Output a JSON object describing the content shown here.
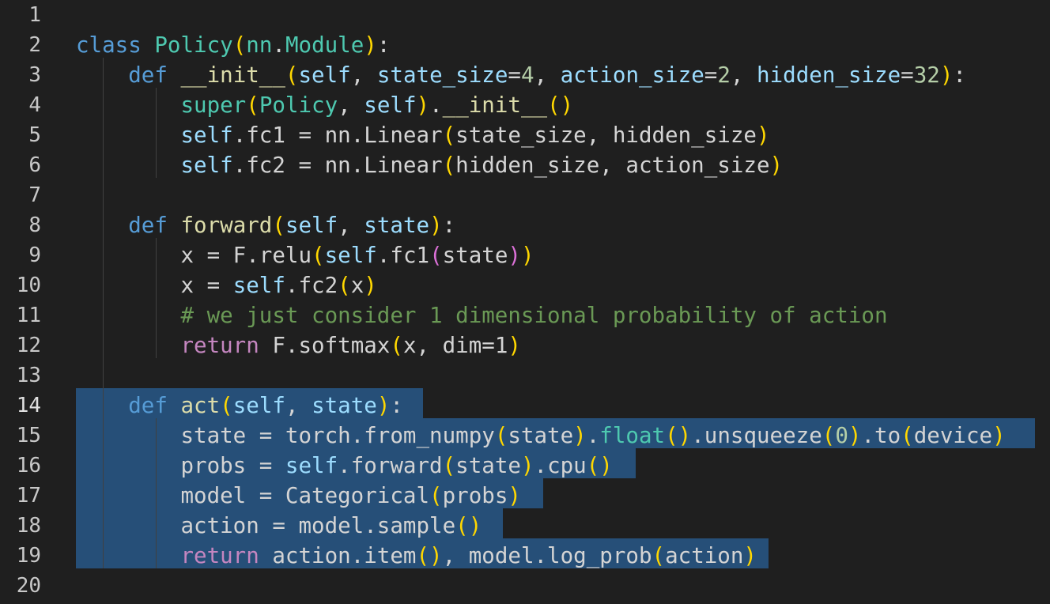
{
  "colors": {
    "background": "#1f1f1f",
    "selection": "#264f78",
    "line_number": "#c8c8c8",
    "default": "#d4d4d4",
    "keyword": "#569cd6",
    "class_name": "#4ec9b0",
    "function": "#dcdcaa",
    "variable": "#9cdcfe",
    "control": "#c586c0",
    "number": "#b5cea8",
    "comment": "#6a9955",
    "bracket_gold": "#ffd700",
    "bracket_purple": "#da70d6"
  },
  "editor": {
    "selection_start_line": 14,
    "selection_end_line": 19,
    "lines": [
      {
        "n": "1",
        "tokens": []
      },
      {
        "n": "2",
        "tokens": [
          [
            "class",
            "keyword"
          ],
          [
            " ",
            "default"
          ],
          [
            "Policy",
            "class_name"
          ],
          [
            "(",
            "bracket_gold"
          ],
          [
            "nn",
            "class_name"
          ],
          [
            ".",
            "default"
          ],
          [
            "Module",
            "class_name"
          ],
          [
            ")",
            "bracket_gold"
          ],
          [
            ":",
            "default"
          ]
        ]
      },
      {
        "n": "3",
        "tokens": [
          [
            "    ",
            "default"
          ],
          [
            "def",
            "keyword"
          ],
          [
            " ",
            "default"
          ],
          [
            "__init__",
            "function"
          ],
          [
            "(",
            "bracket_gold"
          ],
          [
            "self",
            "variable"
          ],
          [
            ", ",
            "default"
          ],
          [
            "state_size",
            "variable"
          ],
          [
            "=",
            "default"
          ],
          [
            "4",
            "number"
          ],
          [
            ", ",
            "default"
          ],
          [
            "action_size",
            "variable"
          ],
          [
            "=",
            "default"
          ],
          [
            "2",
            "number"
          ],
          [
            ", ",
            "default"
          ],
          [
            "hidden_size",
            "variable"
          ],
          [
            "=",
            "default"
          ],
          [
            "32",
            "number"
          ],
          [
            ")",
            "bracket_gold"
          ],
          [
            ":",
            "default"
          ]
        ]
      },
      {
        "n": "4",
        "tokens": [
          [
            "        ",
            "default"
          ],
          [
            "super",
            "class_name"
          ],
          [
            "(",
            "bracket_gold"
          ],
          [
            "Policy",
            "class_name"
          ],
          [
            ", ",
            "default"
          ],
          [
            "self",
            "variable"
          ],
          [
            ")",
            "bracket_gold"
          ],
          [
            ".",
            "default"
          ],
          [
            "__init__",
            "function"
          ],
          [
            "()",
            "bracket_gold"
          ]
        ]
      },
      {
        "n": "5",
        "tokens": [
          [
            "        ",
            "default"
          ],
          [
            "self",
            "variable"
          ],
          [
            ".fc1 = nn.Linear",
            "default"
          ],
          [
            "(",
            "bracket_gold"
          ],
          [
            "state_size, hidden_size",
            "default"
          ],
          [
            ")",
            "bracket_gold"
          ]
        ]
      },
      {
        "n": "6",
        "tokens": [
          [
            "        ",
            "default"
          ],
          [
            "self",
            "variable"
          ],
          [
            ".fc2 = nn.Linear",
            "default"
          ],
          [
            "(",
            "bracket_gold"
          ],
          [
            "hidden_size, action_size",
            "default"
          ],
          [
            ")",
            "bracket_gold"
          ]
        ]
      },
      {
        "n": "7",
        "tokens": []
      },
      {
        "n": "8",
        "tokens": [
          [
            "    ",
            "default"
          ],
          [
            "def",
            "keyword"
          ],
          [
            " ",
            "default"
          ],
          [
            "forward",
            "function"
          ],
          [
            "(",
            "bracket_gold"
          ],
          [
            "self",
            "variable"
          ],
          [
            ", ",
            "default"
          ],
          [
            "state",
            "variable"
          ],
          [
            ")",
            "bracket_gold"
          ],
          [
            ":",
            "default"
          ]
        ]
      },
      {
        "n": "9",
        "tokens": [
          [
            "        ",
            "default"
          ],
          [
            "x = F.relu",
            "default"
          ],
          [
            "(",
            "bracket_gold"
          ],
          [
            "self",
            "variable"
          ],
          [
            ".fc1",
            "default"
          ],
          [
            "(",
            "bracket_purple"
          ],
          [
            "state",
            "default"
          ],
          [
            ")",
            "bracket_purple"
          ],
          [
            ")",
            "bracket_gold"
          ]
        ]
      },
      {
        "n": "10",
        "tokens": [
          [
            "        ",
            "default"
          ],
          [
            "x = ",
            "default"
          ],
          [
            "self",
            "variable"
          ],
          [
            ".fc2",
            "default"
          ],
          [
            "(",
            "bracket_gold"
          ],
          [
            "x",
            "default"
          ],
          [
            ")",
            "bracket_gold"
          ]
        ]
      },
      {
        "n": "11",
        "tokens": [
          [
            "        ",
            "default"
          ],
          [
            "# we just consider 1 dimensional probability of action",
            "comment"
          ]
        ]
      },
      {
        "n": "12",
        "tokens": [
          [
            "        ",
            "default"
          ],
          [
            "return",
            "control"
          ],
          [
            " F.softmax",
            "default"
          ],
          [
            "(",
            "bracket_gold"
          ],
          [
            "x, dim=1",
            "default"
          ],
          [
            ")",
            "bracket_gold"
          ]
        ]
      },
      {
        "n": "13",
        "tokens": []
      },
      {
        "n": "14",
        "tokens": [
          [
            "    ",
            "default"
          ],
          [
            "def",
            "keyword"
          ],
          [
            " ",
            "default"
          ],
          [
            "act",
            "function"
          ],
          [
            "(",
            "bracket_gold"
          ],
          [
            "self",
            "variable"
          ],
          [
            ", ",
            "default"
          ],
          [
            "state",
            "variable"
          ],
          [
            ")",
            "bracket_gold"
          ],
          [
            ":",
            "default"
          ]
        ]
      },
      {
        "n": "15",
        "tokens": [
          [
            "        ",
            "default"
          ],
          [
            "state = torch.from_numpy",
            "default"
          ],
          [
            "(",
            "bracket_gold"
          ],
          [
            "state",
            "default"
          ],
          [
            ")",
            "bracket_gold"
          ],
          [
            ".",
            "default"
          ],
          [
            "float",
            "class_name"
          ],
          [
            "()",
            "bracket_gold"
          ],
          [
            ".unsqueeze",
            "default"
          ],
          [
            "(",
            "bracket_gold"
          ],
          [
            "0",
            "number"
          ],
          [
            ")",
            "bracket_gold"
          ],
          [
            ".to",
            "default"
          ],
          [
            "(",
            "bracket_gold"
          ],
          [
            "device",
            "default"
          ],
          [
            ")",
            "bracket_gold"
          ]
        ]
      },
      {
        "n": "16",
        "tokens": [
          [
            "        ",
            "default"
          ],
          [
            "probs = ",
            "default"
          ],
          [
            "self",
            "variable"
          ],
          [
            ".forward",
            "default"
          ],
          [
            "(",
            "bracket_gold"
          ],
          [
            "state",
            "default"
          ],
          [
            ")",
            "bracket_gold"
          ],
          [
            ".cpu",
            "default"
          ],
          [
            "()",
            "bracket_gold"
          ]
        ]
      },
      {
        "n": "17",
        "tokens": [
          [
            "        ",
            "default"
          ],
          [
            "model = Categorical",
            "default"
          ],
          [
            "(",
            "bracket_gold"
          ],
          [
            "probs",
            "default"
          ],
          [
            ")",
            "bracket_gold"
          ]
        ]
      },
      {
        "n": "18",
        "tokens": [
          [
            "        ",
            "default"
          ],
          [
            "action = model.sample",
            "default"
          ],
          [
            "()",
            "bracket_gold"
          ]
        ]
      },
      {
        "n": "19",
        "tokens": [
          [
            "        ",
            "default"
          ],
          [
            "return",
            "control"
          ],
          [
            " action.item",
            "default"
          ],
          [
            "()",
            "bracket_gold"
          ],
          [
            ", model.log_prob",
            "default"
          ],
          [
            "(",
            "bracket_gold"
          ],
          [
            "action",
            "default"
          ],
          [
            ")",
            "bracket_gold"
          ]
        ]
      },
      {
        "n": "20",
        "tokens": []
      }
    ]
  }
}
